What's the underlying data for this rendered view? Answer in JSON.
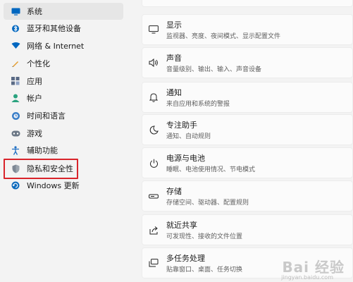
{
  "sidebar": {
    "items": [
      {
        "label": "系统",
        "icon": "monitor-icon",
        "active": true
      },
      {
        "label": "蓝牙和其他设备",
        "icon": "bluetooth-icon"
      },
      {
        "label": "网络 & Internet",
        "icon": "wifi-icon"
      },
      {
        "label": "个性化",
        "icon": "pencil-icon"
      },
      {
        "label": "应用",
        "icon": "apps-icon"
      },
      {
        "label": "帐户",
        "icon": "person-icon"
      },
      {
        "label": "时间和语言",
        "icon": "globe-clock-icon"
      },
      {
        "label": "游戏",
        "icon": "gamepad-icon"
      },
      {
        "label": "辅助功能",
        "icon": "accessibility-icon"
      },
      {
        "label": "隐私和安全性",
        "icon": "shield-icon",
        "highlighted": true
      },
      {
        "label": "Windows 更新",
        "icon": "update-icon"
      }
    ]
  },
  "settings": [
    {
      "title": "显示",
      "subtitle": "监视器、亮度、夜间模式、显示配置文件",
      "icon": "display-icon"
    },
    {
      "title": "声音",
      "subtitle": "音量级别、输出、输入、声音设备",
      "icon": "speaker-icon"
    },
    {
      "title": "通知",
      "subtitle": "来自应用和系统的警报",
      "icon": "bell-icon"
    },
    {
      "title": "专注助手",
      "subtitle": "通知、自动规则",
      "icon": "moon-icon"
    },
    {
      "title": "电源与电池",
      "subtitle": "睡眠、电池使用情况、节电模式",
      "icon": "power-icon"
    },
    {
      "title": "存储",
      "subtitle": "存储空间、驱动器、配置规则",
      "icon": "storage-icon"
    },
    {
      "title": "就近共享",
      "subtitle": "可发现性、接收的文件位置",
      "icon": "share-icon"
    },
    {
      "title": "多任务处理",
      "subtitle": "贴靠窗口、桌面、任务切换",
      "icon": "multitask-icon"
    }
  ],
  "watermark": {
    "text": "Bai 经验",
    "url": "jingyan.baidu.com"
  },
  "colors": {
    "accent": "#0067c0",
    "highlight_border": "#d9242b"
  }
}
